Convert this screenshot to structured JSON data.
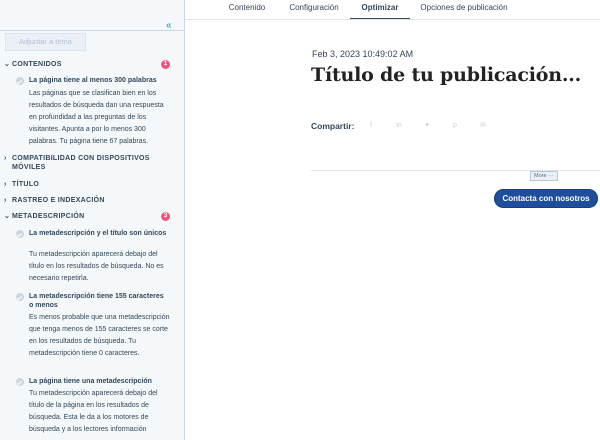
{
  "tabs": [
    "Contenido",
    "Configuración",
    "Optimizar",
    "Opciones de publicación"
  ],
  "sidebar": {
    "collapse_icon": "«",
    "add_theme_button": "Adjuntar a tema",
    "sections": [
      {
        "title": "CONTENIDOS",
        "badge": "1",
        "expanded": true
      },
      {
        "title": "COMPATIBILIDAD CON DISPOSITIVOS MÓVILES",
        "badge": "",
        "expanded": false
      },
      {
        "title": "TÍTULO",
        "badge": "",
        "expanded": false
      },
      {
        "title": "RASTREO E INDEXACIÓN",
        "badge": "",
        "expanded": false
      },
      {
        "title": "METADESCRIPCIÓN",
        "badge": "3",
        "expanded": true
      }
    ],
    "items": [
      {
        "title": "La página tiene al menos 300 palabras",
        "desc": "Las páginas que se clasifican bien en los resultados de búsqueda dan una respuesta en profundidad a las preguntas de los visitantes. Apunta a por lo menos 300 palabras. Tu página tiene 67 palabras."
      },
      {
        "title": "La metadescripción y el título son únicos",
        "desc": "Tu metadescripción aparecerá debajo del título en los resultados de búsqueda. No es necesario repetirla."
      },
      {
        "title": "La metadescripción tiene 155 caracteres o menos",
        "desc": "Es menos probable que una metadescripción que tenga menos de 155 caracteres se corte en los resultados de búsqueda. Tu metadescripción tiene 0 caracteres."
      },
      {
        "title": "La página tiene una metadescripción",
        "desc": "Tu metadescripción aparecerá debajo del título de la página en los resultados de búsqueda. Esta le da a los motores de búsqueda y a los lectores información"
      }
    ]
  },
  "main": {
    "date": "Feb 3, 2023 10:49:02 AM",
    "title": "Título de tu publicación...",
    "share_label": "Compartir:",
    "share_icons": [
      "facebook-icon",
      "linkedin-icon",
      "twitter-icon",
      "pinterest-icon",
      "email-icon"
    ],
    "more_tag": "More ···",
    "cta": "Contacta con nosotros"
  }
}
